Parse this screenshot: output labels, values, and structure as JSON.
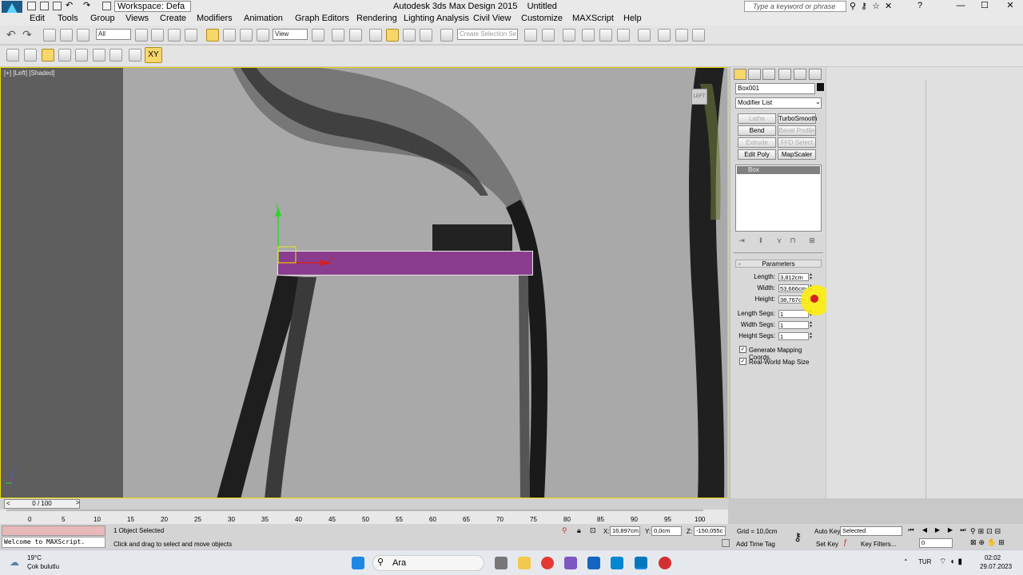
{
  "titlebar": {
    "workspace": "Workspace: Defa",
    "title": "Autodesk 3ds Max Design 2015",
    "doc": "Untitled",
    "search_placeholder": "Type a keyword or phrase"
  },
  "menu": [
    "Edit",
    "Tools",
    "Group",
    "Views",
    "Create",
    "Modifiers",
    "Animation",
    "Graph Editors",
    "Rendering",
    "Lighting Analysis",
    "Civil View",
    "Customize",
    "MAXScript",
    "Help"
  ],
  "toolbar": {
    "selection_filter": "All",
    "ref_coord": "View",
    "selection_set_placeholder": "Create Selection Se",
    "axis_constraint": "XY"
  },
  "viewport": {
    "label": "[+] [Left] [Shaded]",
    "viewcube": "LEFT",
    "gizmo_y": "y",
    "gizmo_x": "x",
    "corner_z": "z",
    "corner_x": "x"
  },
  "command_panel": {
    "object_name": "Box001",
    "modifier_list": "Modifier List",
    "modifier_buttons": [
      {
        "label": "Lathe",
        "enabled": false
      },
      {
        "label": "TurboSmooth",
        "enabled": true
      },
      {
        "label": "Bend",
        "enabled": true
      },
      {
        "label": "Bevel Profile",
        "enabled": false
      },
      {
        "label": "Extrude",
        "enabled": false
      },
      {
        "label": "FFD Select",
        "enabled": false
      },
      {
        "label": "Edit Poly",
        "enabled": true
      },
      {
        "label": "MapScaler",
        "enabled": true
      }
    ],
    "stack_item": "Box",
    "rollout_title": "Parameters",
    "rollout_toggle": "-",
    "params": [
      {
        "label": "Length:",
        "value": "3,812cm"
      },
      {
        "label": "Width:",
        "value": "53,666cm"
      },
      {
        "label": "Height:",
        "value": "38,767cm"
      },
      {
        "label": "Length Segs:",
        "value": "1"
      },
      {
        "label": "Width Segs:",
        "value": "1"
      },
      {
        "label": "Height Segs:",
        "value": "1"
      }
    ],
    "checks": [
      {
        "label": "Generate Mapping Coords.",
        "checked": true
      },
      {
        "label": "Real-World Map Size",
        "checked": true
      }
    ]
  },
  "timeline": {
    "slider": "0 / 100",
    "ticks": [
      "0",
      "5",
      "10",
      "15",
      "20",
      "25",
      "30",
      "35",
      "40",
      "45",
      "50",
      "55",
      "60",
      "65",
      "70",
      "75",
      "80",
      "85",
      "90",
      "95",
      "100"
    ]
  },
  "status": {
    "maxscript": "Welcome to MAXScript.",
    "selected": "1 Object Selected",
    "prompt": "Click and drag to select and move objects",
    "x_label": "X:",
    "x": "16,897cm",
    "y_label": "Y:",
    "y": "0,0cm",
    "z_label": "Z:",
    "z": "-150,055c",
    "grid": "Grid = 10,0cm",
    "add_time_tag": "Add Time Tag",
    "auto_key": "Auto Key",
    "set_key": "Set Key",
    "key_mode": "Selected",
    "key_filters": "Key Filters...",
    "frame": "0"
  },
  "taskbar": {
    "temp": "19°C",
    "weather": "Çok bulutlu",
    "search": "Ara",
    "lang": "TUR",
    "time": "02:02",
    "date": "29.07.2023"
  },
  "colors": {
    "viewport_bg": "#a9a9a9",
    "selected_box": "#8a3d8e",
    "viewport_border": "#e8d800",
    "cursor_highlight": "#fff000"
  }
}
